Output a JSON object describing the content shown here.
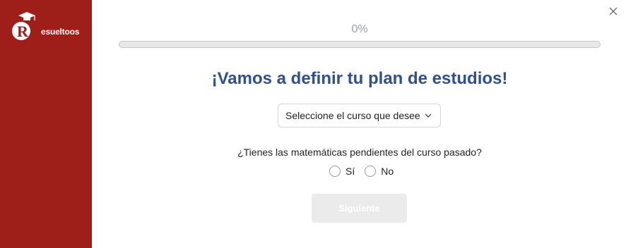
{
  "brand": {
    "name": "esueltoos",
    "logo_letter": "R",
    "sidebar_color": "#9e1f1a"
  },
  "progress": {
    "label": "0%",
    "value": 0
  },
  "title": "¡Vamos a definir tu plan de estudios!",
  "course_select": {
    "placeholder": "Seleccione el curso que desee",
    "icon": "chevron-down-icon"
  },
  "question": {
    "text": "¿Tienes las matemáticas pendientes del curso pasado?",
    "options": [
      "Sí",
      "No"
    ]
  },
  "next_button": {
    "label": "Siguiente",
    "disabled": true
  },
  "close_icon": "close-icon",
  "colors": {
    "accent": "#2f4f8f",
    "sidebar": "#9e1f1a",
    "disabled_button": "#ebebeb"
  }
}
